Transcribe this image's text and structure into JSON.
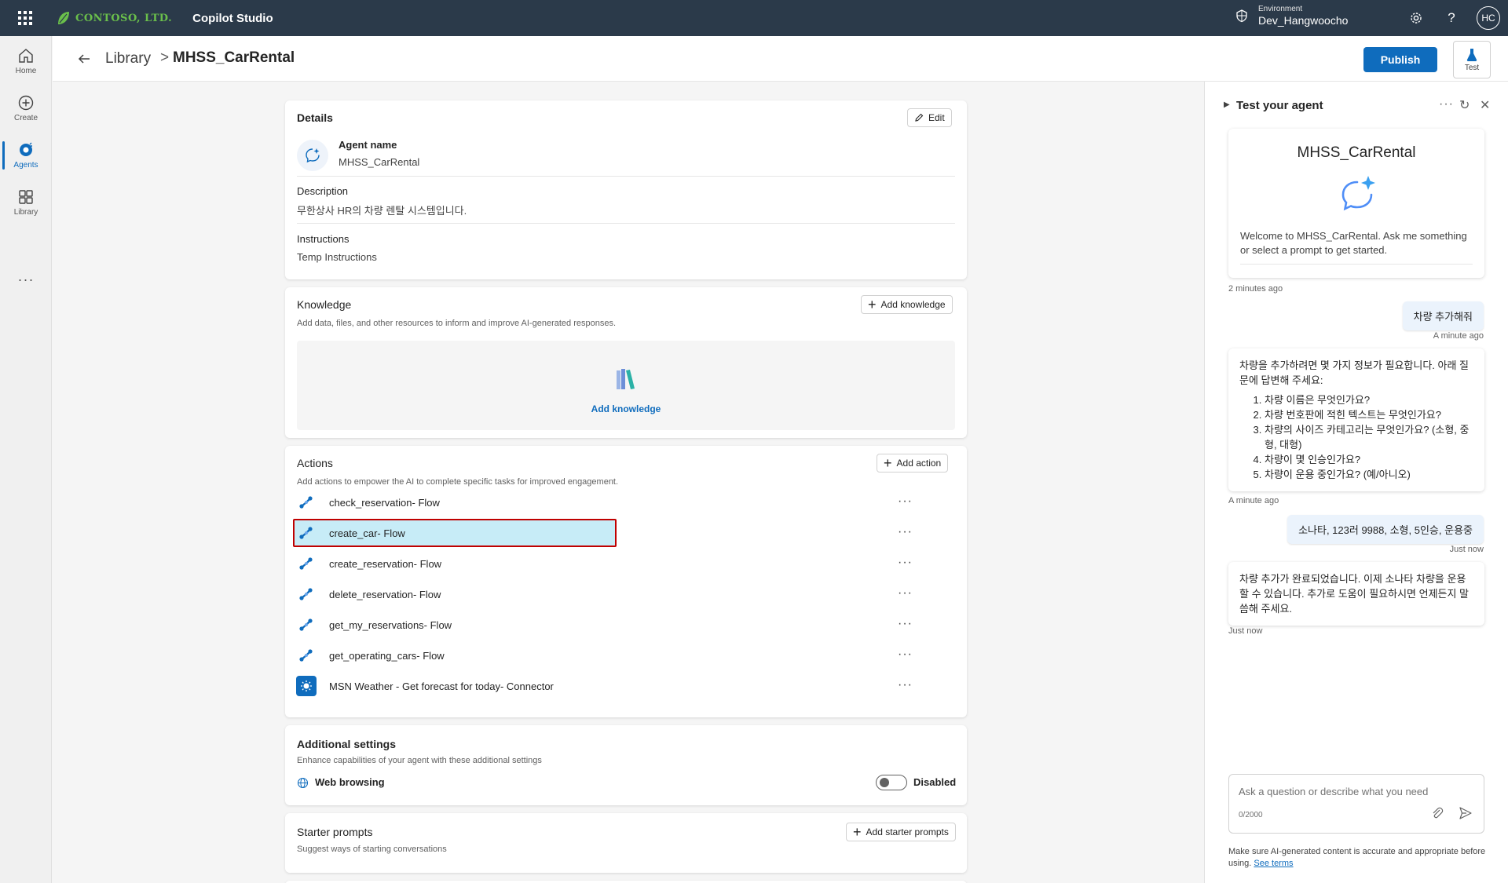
{
  "topbar": {
    "brand": "CONTOSO, LTD.",
    "product": "Copilot Studio",
    "environment_label": "Environment",
    "environment_value": "Dev_Hangwoocho",
    "avatar_initials": "HC"
  },
  "rail": {
    "items": [
      {
        "label": "Home",
        "icon": "home-icon"
      },
      {
        "label": "Create",
        "icon": "plus-circle-icon"
      },
      {
        "label": "Agents",
        "icon": "agents-icon"
      },
      {
        "label": "Library",
        "icon": "library-icon"
      }
    ],
    "more": "···"
  },
  "header": {
    "breadcrumb_library": "Library",
    "breadcrumb_separator": ">",
    "breadcrumb_current": "MHSS_CarRental",
    "publish_label": "Publish",
    "test_label": "Test"
  },
  "details": {
    "title": "Details",
    "edit_label": "Edit",
    "agent_name_label": "Agent name",
    "agent_name_value": "MHSS_CarRental",
    "description_label": "Description",
    "description_value": "무한상사 HR의 차량 렌탈 시스템입니다.",
    "instructions_label": "Instructions",
    "instructions_value": "Temp Instructions"
  },
  "knowledge": {
    "title": "Knowledge",
    "add_label": "Add knowledge",
    "subtitle": "Add data, files, and other resources to inform and improve AI-generated responses.",
    "link_label": "Add knowledge"
  },
  "actions": {
    "title": "Actions",
    "add_label": "Add action",
    "subtitle": "Add actions to empower the AI to complete specific tasks for improved engagement.",
    "items": [
      {
        "name": "check_reservation- Flow",
        "type": "flow",
        "selected": false
      },
      {
        "name": "create_car- Flow",
        "type": "flow",
        "selected": true
      },
      {
        "name": "create_reservation- Flow",
        "type": "flow",
        "selected": false
      },
      {
        "name": "delete_reservation- Flow",
        "type": "flow",
        "selected": false
      },
      {
        "name": "get_my_reservations- Flow",
        "type": "flow",
        "selected": false
      },
      {
        "name": "get_operating_cars- Flow",
        "type": "flow",
        "selected": false
      },
      {
        "name": "MSN Weather - Get forecast for today- Connector",
        "type": "connector",
        "selected": false
      }
    ],
    "more_label": "···"
  },
  "additional": {
    "title": "Additional settings",
    "subtitle": "Enhance capabilities of your agent with these additional settings",
    "web_browsing_label": "Web browsing",
    "web_browsing_status": "Disabled",
    "web_browsing_enabled": false
  },
  "starter": {
    "title": "Starter prompts",
    "subtitle": "Suggest ways of starting conversations",
    "add_label": "Add starter prompts"
  },
  "test_panel": {
    "title": "Test your agent",
    "welcome_name": "MHSS_CarRental",
    "welcome_text": "Welcome to MHSS_CarRental. Ask me something or select a prompt to get started.",
    "welcome_time": "2 minutes ago",
    "messages": [
      {
        "role": "user",
        "text": "차량 추가해줘",
        "time": "A minute ago"
      },
      {
        "role": "bot",
        "intro": "차량을 추가하려면 몇 가지 정보가 필요합니다. 아래 질문에 답변해 주세요:",
        "list": [
          "차량 이름은 무엇인가요?",
          "차량 번호판에 적힌 텍스트는 무엇인가요?",
          "차량의 사이즈 카테고리는 무엇인가요? (소형, 중형, 대형)",
          "차량이 몇 인승인가요?",
          "차량이 운용 중인가요? (예/아니오)"
        ],
        "time": "A minute ago"
      },
      {
        "role": "user",
        "text": "소나타, 123러 9988, 소형, 5인승, 운용중",
        "time": "Just now"
      },
      {
        "role": "bot",
        "intro": "차량 추가가 완료되었습니다. 이제 소나타 차량을 운용할 수 있습니다. 추가로 도움이 필요하시면 언제든지 말씀해 주세요.",
        "list": [],
        "time": "Just now"
      }
    ],
    "input_placeholder": "Ask a question or describe what you need",
    "input_count": "0/2000",
    "disclaimer_text": "Make sure AI-generated content is accurate and appropriate before using.",
    "disclaimer_link": "See terms"
  },
  "colors": {
    "topbar": "#2b3a4a",
    "accent": "#0f6cbd",
    "brand_green": "#6abf4b",
    "selected_row": "#c7ecf7",
    "highlight_border": "#c00000"
  }
}
